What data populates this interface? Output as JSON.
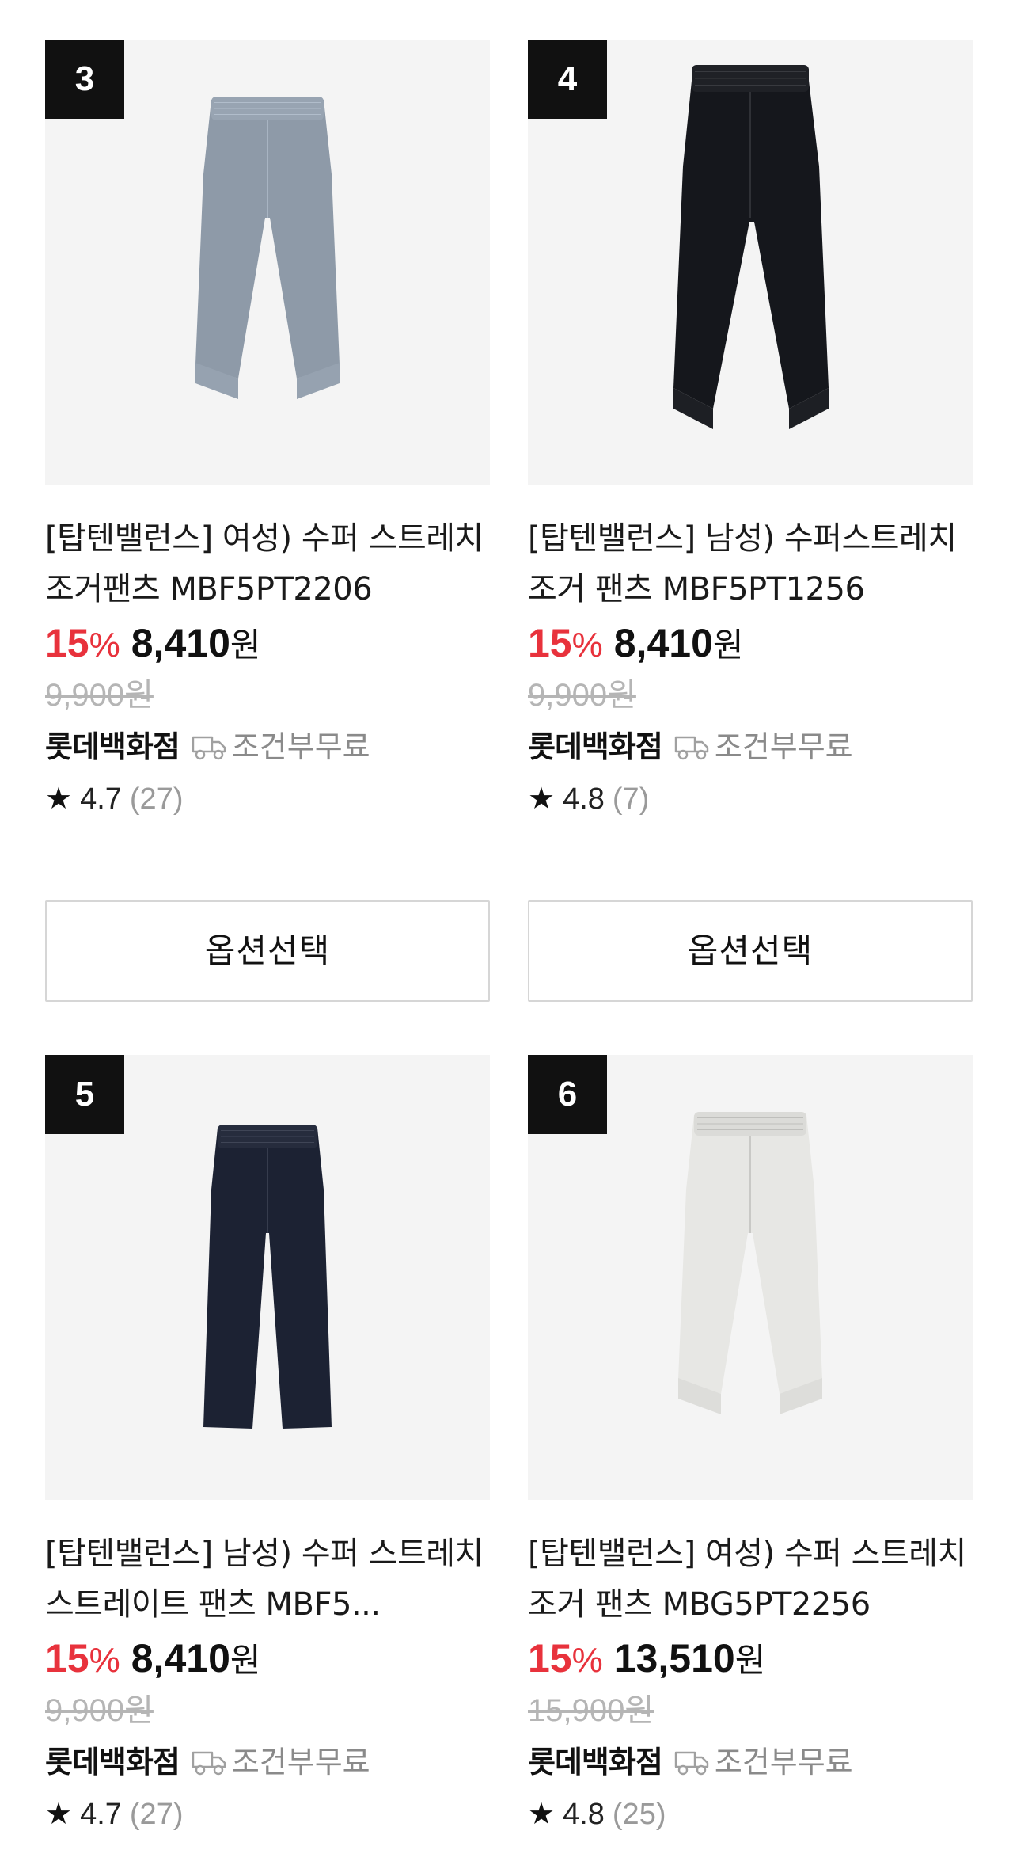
{
  "products": [
    {
      "rank": "3",
      "title": "[탑텐밸런스] 여성) 수퍼 스트레치 조거팬츠 MBF5PT2206",
      "discount": "15",
      "discount_unit": "%",
      "price": "8,410",
      "price_unit": "원",
      "original_price": "9,900원",
      "seller": "롯데백화점",
      "shipping": "조건부무료",
      "star_icon": "★",
      "rating": "4.7",
      "review_count": "(27)",
      "option_button": "옵션선택",
      "pants_color": "#8e9aa8"
    },
    {
      "rank": "4",
      "title": "[탑텐밸런스] 남성) 수퍼스트레치 조거 팬츠 MBF5PT1256",
      "discount": "15",
      "discount_unit": "%",
      "price": "8,410",
      "price_unit": "원",
      "original_price": "9,900원",
      "seller": "롯데백화점",
      "shipping": "조건부무료",
      "star_icon": "★",
      "rating": "4.8",
      "review_count": "(7)",
      "option_button": "옵션선택",
      "pants_color": "#15171c"
    },
    {
      "rank": "5",
      "title": "[탑텐밸런스] 남성) 수퍼 스트레치 스트레이트 팬츠 MBF5...",
      "discount": "15",
      "discount_unit": "%",
      "price": "8,410",
      "price_unit": "원",
      "original_price": "9,900원",
      "seller": "롯데백화점",
      "shipping": "조건부무료",
      "star_icon": "★",
      "rating": "4.7",
      "review_count": "(27)",
      "pants_color": "#1c2233"
    },
    {
      "rank": "6",
      "title": "[탑텐밸런스] 여성) 수퍼 스트레치 조거 팬츠 MBG5PT2256",
      "discount": "15",
      "discount_unit": "%",
      "price": "13,510",
      "price_unit": "원",
      "original_price": "15,900원",
      "seller": "롯데백화점",
      "shipping": "조건부무료",
      "star_icon": "★",
      "rating": "4.8",
      "review_count": "(25)",
      "pants_color": "#e7e7e4"
    }
  ],
  "icons": {
    "shipping": "truck-icon",
    "rating": "star-icon"
  },
  "colors": {
    "discount": "#e8323c",
    "original_price": "#b5b5b5",
    "shipping_text": "#8a8a8a"
  }
}
